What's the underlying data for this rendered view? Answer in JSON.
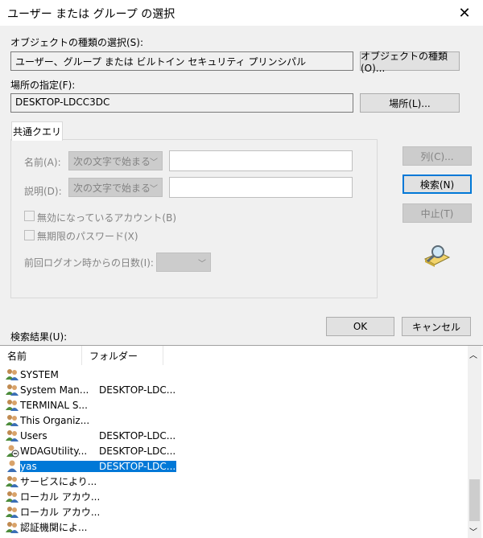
{
  "window": {
    "title": "ユーザー または グループ の選択",
    "close_glyph": "✕"
  },
  "object_type": {
    "label": "オブジェクトの種類の選択(S):",
    "value": "ユーザー、グループ または ビルトイン セキュリティ プリンシパル",
    "button": "オブジェクトの種類(O)..."
  },
  "location": {
    "label": "場所の指定(F):",
    "value": "DESKTOP-LDCC3DC",
    "button": "場所(L)..."
  },
  "query": {
    "tab": "共通クエリ",
    "name_label": "名前(A):",
    "desc_label": "説明(D):",
    "name_mode": "次の文字で始まる",
    "desc_mode": "次の文字で始まる",
    "disabled_accounts": "無効になっているアカウント(B)",
    "no_expire_pw": "無期限のパスワード(X)",
    "days_since_logon": "前回ログオン時からの日数(I):"
  },
  "side_buttons": {
    "columns": "列(C)...",
    "search": "検索(N)",
    "stop": "中止(T)"
  },
  "dialog_buttons": {
    "ok": "OK",
    "cancel": "キャンセル"
  },
  "results": {
    "label": "検索結果(U):",
    "columns": [
      "名前",
      "フォルダー"
    ],
    "rows": [
      {
        "name": "SYSTEM",
        "folder": "",
        "icon": "group-icon"
      },
      {
        "name": "System Man...",
        "folder": "DESKTOP-LDC...",
        "icon": "group-icon"
      },
      {
        "name": "TERMINAL S...",
        "folder": "",
        "icon": "group-icon"
      },
      {
        "name": "This Organiz...",
        "folder": "",
        "icon": "group-icon"
      },
      {
        "name": "Users",
        "folder": "DESKTOP-LDC...",
        "icon": "group-icon"
      },
      {
        "name": "WDAGUtility...",
        "folder": "DESKTOP-LDC...",
        "icon": "disabled-user-icon"
      },
      {
        "name": "yas",
        "folder": "DESKTOP-LDC...",
        "icon": "user-icon"
      },
      {
        "name": "サービスにより...",
        "folder": "",
        "icon": "group-icon"
      },
      {
        "name": "ローカル アカウ...",
        "folder": "",
        "icon": "group-icon"
      },
      {
        "name": "ローカル アカウ...",
        "folder": "",
        "icon": "group-icon"
      },
      {
        "name": "認証機関によ...",
        "folder": "",
        "icon": "group-icon"
      }
    ],
    "selected_index": 6
  },
  "colors": {
    "accent": "#0078d7",
    "disabled_text": "#838383"
  }
}
